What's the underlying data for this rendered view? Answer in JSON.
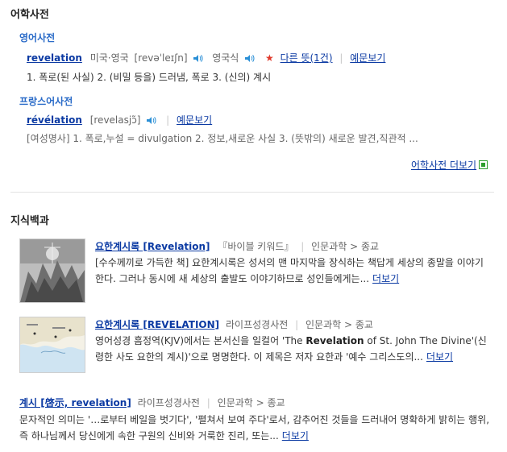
{
  "dict": {
    "title": "어학사전",
    "en": {
      "heading": "영어사전",
      "word": "revelation",
      "region1": "미국·영국",
      "pron": "[revəˈleɪʃn]",
      "region2": "영국식",
      "other_meanings": "다른 뜻(1건)",
      "examples": "예문보기",
      "meaning": "1. 폭로(된 사실)    2. (비밀 등을) 드러냄, 폭로    3. (신의) 계시"
    },
    "fr": {
      "heading": "프랑스어사전",
      "word": "révélation",
      "pron": "[revelasjɔ̃]",
      "examples": "예문보기",
      "meaning": "[여성명사] 1. 폭로,누설 = divulgation 2. 정보,새로운 사실 3. (뜻밖의) 새로운 발견,직관적 ..."
    },
    "more": "어학사전 더보기"
  },
  "knowledge": {
    "title": "지식백과",
    "entries": [
      {
        "title": "요한계시록 [Revelation]",
        "source": "『바이블 키워드』",
        "category": "인문과학 > 종교",
        "desc": "[수수께끼로 가득한 책] 요한계시록은 성서의 맨 마지막을 장식하는 책답게 세상의 종말을 이야기한다. 그러나 동시에 새 세상의 출발도 이야기하므로 성인들에게는...",
        "more": "더보기",
        "thumb_icon": "painting-thumbnail-icon"
      },
      {
        "title": "요한계시록 [REVELATION]",
        "source": "라이프성경사전",
        "category": "인문과학 > 종교",
        "desc_pre": "영어성경 흠정역(KJV)에서는 본서신을 일컬어 'The ",
        "desc_bold": "Revelation",
        "desc_post": " of St. John The Divine'(신령한 사도 요한의 계시)'으로 명명한다. 이 제목은 저자 요한과 '예수 그리스도의...",
        "more": "더보기",
        "thumb_icon": "map-thumbnail-icon"
      },
      {
        "title": "계시 [啓示, revelation]",
        "source": "라이프성경사전",
        "category": "인문과학 > 종교",
        "desc": "문자적인 의미는 '…로부터 베일을 벗기다', '펼쳐서 보여 주다'로서, 감추어진 것들을 드러내어 명확하게 밝히는 행위, 즉 하나님께서 당신에게 속한 구원의 신비와 거룩한 진리, 또는...",
        "more": "더보기"
      }
    ]
  },
  "colors": {
    "link": "#0b3aa3",
    "subheading": "#2a6bc8",
    "star": "#e0392b",
    "text": "#333333"
  }
}
